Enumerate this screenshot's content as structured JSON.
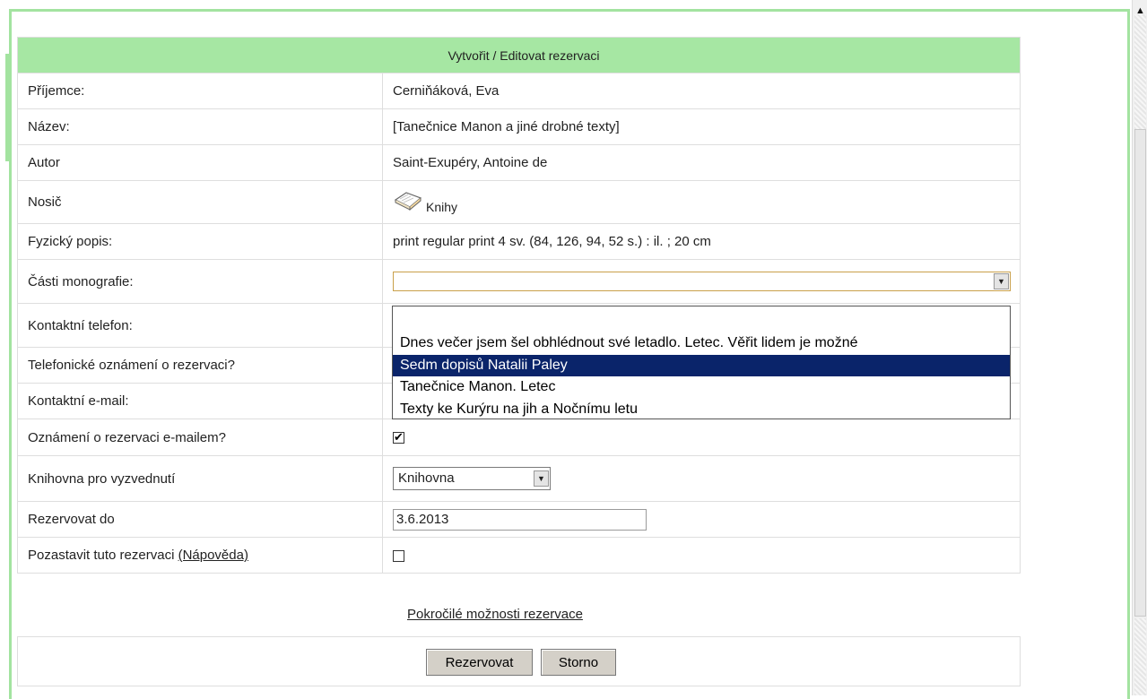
{
  "form": {
    "title": "Vytvořit / Editovat rezervaci",
    "rows": {
      "recipient": {
        "label": "Příjemce:",
        "value": "Cerniňáková, Eva"
      },
      "title": {
        "label": "Název:",
        "value": "[Tanečnice Manon a jiné drobné texty]"
      },
      "author": {
        "label": "Autor",
        "value": "Saint-Exupéry, Antoine de"
      },
      "medium": {
        "label": "Nosič",
        "value": "Knihy",
        "icon": "book-icon"
      },
      "physical": {
        "label": "Fyzický popis:",
        "value": "print regular print 4 sv. (84, 126, 94, 52 s.) : il. ; 20 cm"
      },
      "parts": {
        "label": "Části monografie:",
        "value": ""
      },
      "phone": {
        "label": "Kontaktní telefon:"
      },
      "phone_notify": {
        "label": "Telefonické oznámení o rezervaci?"
      },
      "email": {
        "label": "Kontaktní e-mail:"
      },
      "email_notify": {
        "label": "Oznámení o rezervaci e-mailem?",
        "checked": true
      },
      "library": {
        "label": "Knihovna pro vyzvednutí",
        "value": "Knihovna"
      },
      "reserve_until": {
        "label": "Rezervovat do",
        "value": "3.6.2013"
      },
      "suspend": {
        "label": "Pozastavit tuto rezervaci",
        "help": "(Nápověda)",
        "checked": false
      }
    }
  },
  "dropdown": {
    "options": [
      "",
      "Dnes večer jsem šel obhlédnout své letadlo. Letec. Věřit lidem je možné",
      "Sedm dopisů Natalii Paley",
      "Tanečnice Manon. Letec",
      "Texty ke Kurýru na jih a Nočnímu letu"
    ],
    "selected_index": 2
  },
  "advanced_link": "Pokročilé možnosti rezervace",
  "buttons": {
    "reserve": "Rezervovat",
    "cancel": "Storno"
  },
  "colors": {
    "header_bg": "#a6e7a3",
    "frame": "#a3e3a0",
    "selection": "#0a246a"
  }
}
